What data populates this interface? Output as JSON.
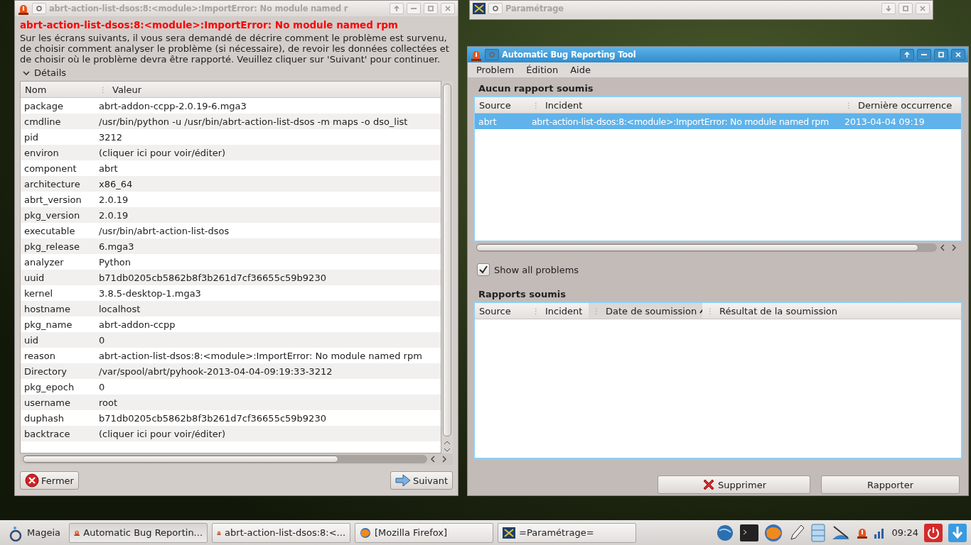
{
  "details_window": {
    "title": "abrt-action-list-dsos:8:<module>:ImportError: No module named r",
    "active": false,
    "heading": "abrt-action-list-dsos:8:<module>:ImportError: No module named rpm",
    "description": "Sur les écrans suivants, il vous sera demandé de décrire comment le problème est survenu, de choisir comment analyser le problème (si nécessaire), de revoir les données collectées et de choisir où le problème devra être rapporté. Veuillez cliquer sur 'Suivant' pour continuer.",
    "details": {
      "label": "Détails",
      "expanded": true
    },
    "columns": [
      {
        "label": "Nom"
      },
      {
        "label": "Valeur",
        "separator": "⋮"
      }
    ],
    "rows": [
      {
        "name": "package",
        "value": "abrt-addon-ccpp-2.0.19-6.mga3"
      },
      {
        "name": "cmdline",
        "value": "/usr/bin/python -u /usr/bin/abrt-action-list-dsos -m maps -o dso_list"
      },
      {
        "name": "pid",
        "value": "3212"
      },
      {
        "name": "environ",
        "value": "(cliquer ici pour voir/éditer)"
      },
      {
        "name": "component",
        "value": "abrt"
      },
      {
        "name": "architecture",
        "value": "x86_64"
      },
      {
        "name": "abrt_version",
        "value": "2.0.19"
      },
      {
        "name": "pkg_version",
        "value": "2.0.19"
      },
      {
        "name": "executable",
        "value": "/usr/bin/abrt-action-list-dsos"
      },
      {
        "name": "pkg_release",
        "value": "6.mga3"
      },
      {
        "name": "analyzer",
        "value": "Python"
      },
      {
        "name": "uuid",
        "value": "b71db0205cb5862b8f3b261d7cf36655c59b9230"
      },
      {
        "name": "kernel",
        "value": "3.8.5-desktop-1.mga3"
      },
      {
        "name": "hostname",
        "value": "localhost"
      },
      {
        "name": "pkg_name",
        "value": "abrt-addon-ccpp"
      },
      {
        "name": "uid",
        "value": "0"
      },
      {
        "name": "reason",
        "value": "abrt-action-list-dsos:8:<module>:ImportError: No module named rpm"
      },
      {
        "name": "Directory",
        "value": "/var/spool/abrt/pyhook-2013-04-04-09:19:33-3212"
      },
      {
        "name": "pkg_epoch",
        "value": "0"
      },
      {
        "name": "username",
        "value": "root"
      },
      {
        "name": "duphash",
        "value": "b71db0205cb5862b8f3b261d7cf36655c59b9230"
      },
      {
        "name": "backtrace",
        "value": "(cliquer ici pour voir/éditer)"
      }
    ],
    "buttons": [
      {
        "label": "Fermer",
        "kind": "close"
      },
      {
        "label": "Suivant",
        "kind": "next"
      }
    ]
  },
  "settings_window": {
    "title": "Paramétrage",
    "active": false
  },
  "main_window": {
    "title": "Automatic Bug Reporting Tool",
    "active": true,
    "menu": [
      "Problem",
      "Édition",
      "Aide"
    ],
    "unsubmitted": {
      "title": "Aucun rapport soumis",
      "columns": [
        {
          "label": "Source",
          "sorted": false
        },
        {
          "label": "Incident",
          "separator": "⋮",
          "sorted": false
        },
        {
          "label": "Dernière occurrence",
          "separator": "⋮",
          "sorted": false
        }
      ],
      "rows": [
        {
          "source": "abrt",
          "incident": "abrt-action-list-dsos:8:<module>:ImportError: No module named rpm",
          "date": "2013-04-04 09:19",
          "selected": true
        }
      ]
    },
    "show_all": {
      "label": "Show all problems",
      "checked": true
    },
    "submitted": {
      "title": "Rapports soumis",
      "columns": [
        {
          "label": "Source",
          "sorted": false
        },
        {
          "label": "Incident",
          "separator": "⋮",
          "sorted": false
        },
        {
          "label": "Date de soumission",
          "separator": "⋮",
          "sorted": true
        },
        {
          "label": "Résultat de la soumission",
          "separator": "⋮",
          "sorted": false
        }
      ]
    },
    "buttons": [
      {
        "label": "Supprimer",
        "kind": "delete"
      },
      {
        "label": "Rapporter",
        "kind": "plain"
      }
    ]
  },
  "taskbar": {
    "start": "Mageia",
    "tasks": [
      {
        "label": "Automatic Bug Reportin...",
        "kind": "bug",
        "selected": true
      },
      {
        "label": "abrt-action-list-dsos:8:<...",
        "kind": "bug",
        "selected": false
      },
      {
        "label": "[Mozilla Firefox]",
        "kind": "browser",
        "selected": false
      },
      {
        "label": "=Paramétrage=",
        "kind": "settings",
        "selected": false
      }
    ],
    "clock": "09:24"
  }
}
